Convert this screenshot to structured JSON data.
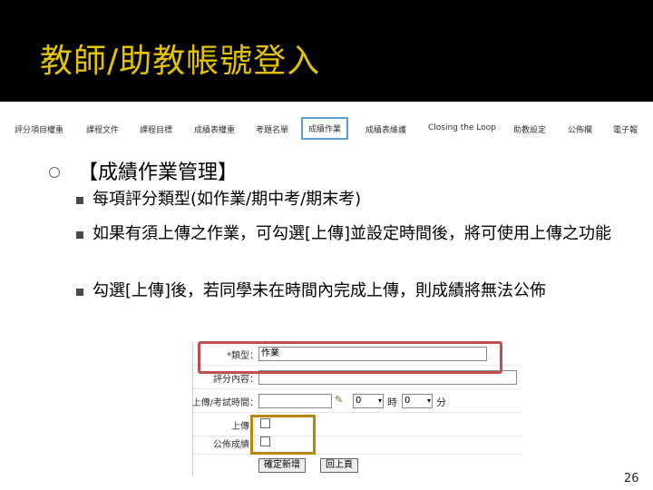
{
  "slide": {
    "title": "教師/助教帳號登入",
    "page_number": "26",
    "colors": {
      "title": "#e3c200",
      "title_bg": "#000000",
      "red_highlight": "#c0504d",
      "gold_highlight": "#b8860b",
      "active_tab_border": "#5aa0d8"
    }
  },
  "nav": {
    "items": [
      "評分項目權重",
      "課程文件",
      "課程目標",
      "成績表權重",
      "考題名單",
      "成績作業",
      "成績表維護",
      "Closing the Loop",
      "助教設定",
      "公佈欄",
      "電子報"
    ],
    "active_index": 5
  },
  "content": {
    "heading": "【成績作業管理】",
    "bullets": [
      "每項評分類型(如作業/期中考/期末考)",
      "如果有須上傳之作業，可勾選[上傳]並設定時間後，將可使用上傳之功能",
      "勾選[上傳]後，若同學未在時間內完成上傳，則成績將無法公佈"
    ]
  },
  "form": {
    "type_label": "*類型：",
    "type_value": "作業",
    "desc_label": "評分內容：",
    "desc_value": "",
    "time_label": "上傳/考試時間：",
    "hour_value": "0",
    "hour_unit": "時",
    "minute_value": "0",
    "minute_unit": "分",
    "upload_label": "上傳：",
    "publish_label": "公佈成績：",
    "submit_label": "確定新增",
    "back_label": "回上頁"
  }
}
